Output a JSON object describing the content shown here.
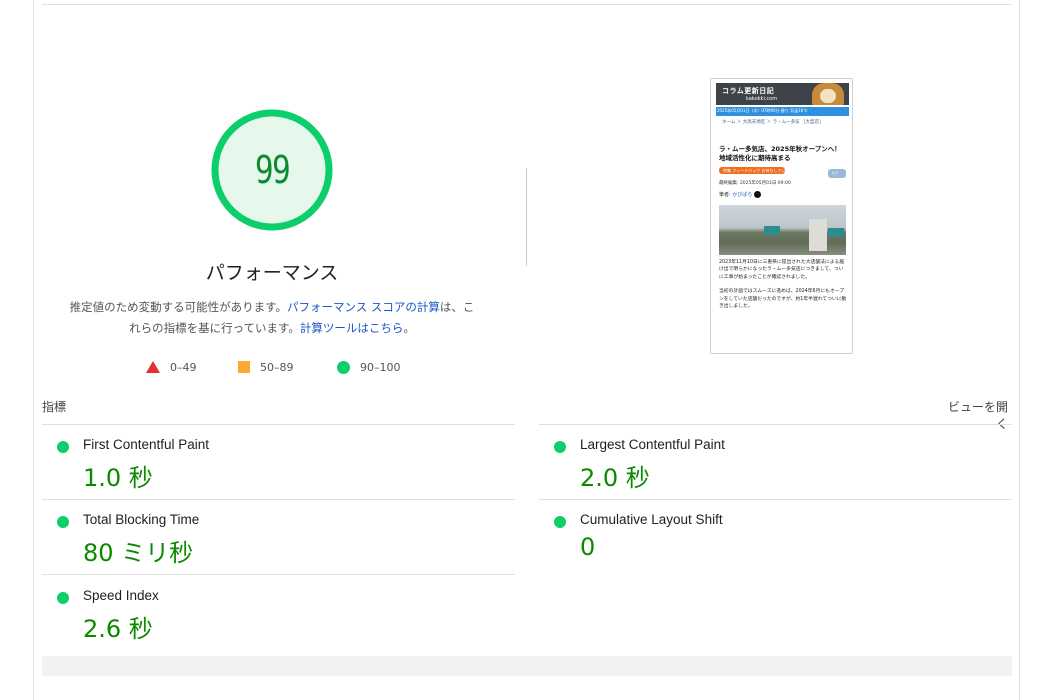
{
  "summary": {
    "score": "99",
    "title": "パフォーマンス",
    "desc_part1": "推定値のため変動する可能性があります。",
    "desc_link1": "パフォーマンス スコアの計算",
    "desc_part2": "は、これらの指標を基に行っています。",
    "desc_link2": "計算ツールはこちら",
    "desc_part3": "。",
    "colors": {
      "pass": "#0cce6b",
      "average": "#ffa833",
      "fail": "#e52e2e",
      "score_text": "#0b8a30"
    }
  },
  "legend": [
    {
      "shape": "triangle",
      "range": "0–49"
    },
    {
      "shape": "square",
      "range": "50–89"
    },
    {
      "shape": "circle",
      "range": "90–100"
    }
  ],
  "thumbnail": {
    "header_title": "コラム更新日記",
    "header_sub": "kakokki.com",
    "bluebar": "2025年05月01日（木）07時00分 曇り 気温16℃",
    "breadcrumb": "ホーム ＞ 大高天地区 ＞ ラ・ムー多気 ［大型店］",
    "article_title": "ラ・ムー多気店、2025年秋オープンへ！地域活性化に期待高まる",
    "tag": "特集 フィードバック お待ちしています",
    "button": "ｼｪｱ",
    "date": "最終編集: 2025年05月01日 09:00",
    "author_label": "筆者: ",
    "author_name": "かびぱら",
    "body1": "2023年11月10日に三重県に提出された大店舗法による届け出で明らかになったラ・ムー多気店につきまして、ついに工事が始まったことが確認されました。",
    "body2": "当初の計画ではスムーズに進めば、2024年6月にもオープンをしていた店舗だったのですが、約1年半遅れてついに動き出しました。"
  },
  "metrics_header": {
    "label": "指標",
    "view_toggle": "ビューを開く"
  },
  "metrics": {
    "fcp": {
      "title": "First Contentful Paint",
      "value": "1.0 秒"
    },
    "lcp": {
      "title": "Largest Contentful Paint",
      "value": "2.0 秒"
    },
    "tbt": {
      "title": "Total Blocking Time",
      "value": "80 ミリ秒"
    },
    "cls": {
      "title": "Cumulative Layout Shift",
      "value": "0"
    },
    "si": {
      "title": "Speed Index",
      "value": "2.6 秒"
    }
  }
}
